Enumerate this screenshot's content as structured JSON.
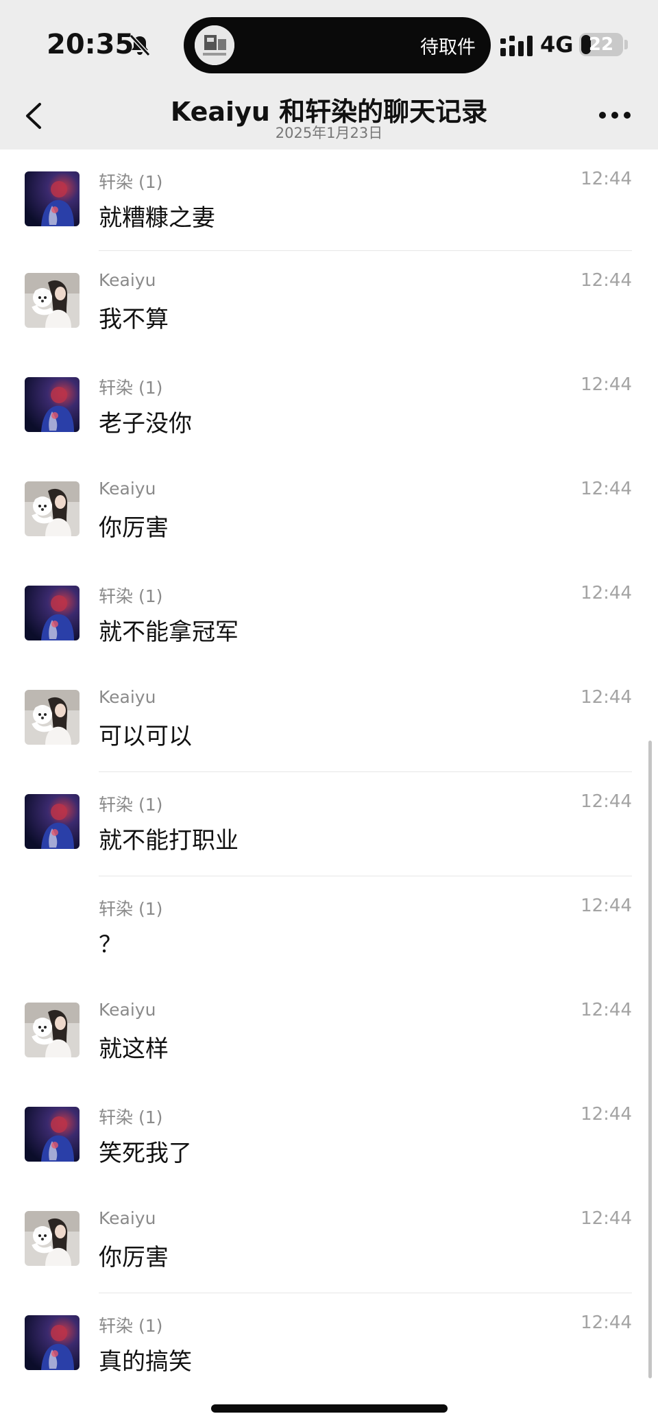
{
  "status_bar": {
    "time": "20:35",
    "island_text": "待取件",
    "network": "4G",
    "battery": "22"
  },
  "nav": {
    "title": "Keaiyu 和轩染的聊天记录",
    "date": "2025年1月23日"
  },
  "messages": [
    {
      "sender": "轩染 (1)",
      "time": "12:44",
      "text": "就糟糠之妻",
      "avatar": "xuanran"
    },
    {
      "sender": "Keaiyu",
      "time": "12:44",
      "text": "我不算",
      "avatar": "keaiyu"
    },
    {
      "sender": "轩染 (1)",
      "time": "12:44",
      "text": "老子没你",
      "avatar": "xuanran"
    },
    {
      "sender": "Keaiyu",
      "time": "12:44",
      "text": "你厉害",
      "avatar": "keaiyu"
    },
    {
      "sender": "轩染 (1)",
      "time": "12:44",
      "text": "就不能拿冠军",
      "avatar": "xuanran"
    },
    {
      "sender": "Keaiyu",
      "time": "12:44",
      "text": "可以可以",
      "avatar": "keaiyu"
    },
    {
      "sender": "轩染 (1)",
      "time": "12:44",
      "text": "就不能打职业",
      "avatar": "xuanran"
    },
    {
      "sender": "轩染 (1)",
      "time": "12:44",
      "text": "？",
      "avatar": "none"
    },
    {
      "sender": "Keaiyu",
      "time": "12:44",
      "text": "就这样",
      "avatar": "keaiyu"
    },
    {
      "sender": "轩染 (1)",
      "time": "12:44",
      "text": "笑死我了",
      "avatar": "xuanran"
    },
    {
      "sender": "Keaiyu",
      "time": "12:44",
      "text": "你厉害",
      "avatar": "keaiyu"
    },
    {
      "sender": "轩染 (1)",
      "time": "12:44",
      "text": "真的搞笑",
      "avatar": "xuanran"
    }
  ]
}
